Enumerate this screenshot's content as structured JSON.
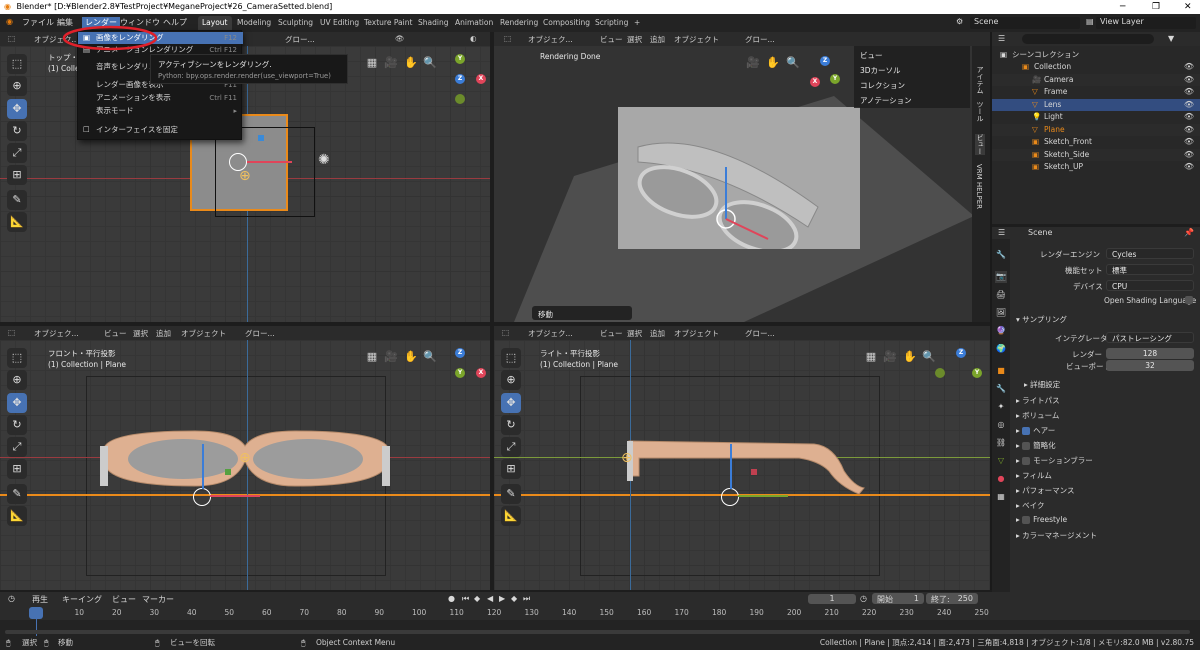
{
  "window": {
    "title": "Blender* [D:¥Blender2.8¥TestProject¥MeganeProject¥26_CameraSetted.blend]",
    "minimize": "─",
    "maximize": "❐",
    "close": "✕"
  },
  "topbar": {
    "menus": [
      "ファイル",
      "編集",
      "レンダー",
      "ウィンドウ",
      "ヘルプ"
    ],
    "workspaces": [
      "Layout",
      "Modeling",
      "Sculpting",
      "UV Editing",
      "Texture Paint",
      "Shading",
      "Animation",
      "Rendering",
      "Compositing",
      "Scripting",
      "+"
    ],
    "active_workspace": "Layout",
    "scene": "Scene",
    "view_layer": "View Layer"
  },
  "render_menu": {
    "items": [
      {
        "label": "画像をレンダリング",
        "shortcut": "F12",
        "icon": "📷"
      },
      {
        "label": "アニメーションレンダリング",
        "shortcut": "Ctrl F12",
        "icon": "🎞"
      },
      {
        "label": "音声をレンダリング...",
        "shortcut": "",
        "icon": ""
      },
      {
        "label": "レンダー画像を表示",
        "shortcut": "F11",
        "icon": ""
      },
      {
        "label": "アニメーションを表示",
        "shortcut": "Ctrl F11",
        "icon": ""
      },
      {
        "label": "表示モード",
        "shortcut": "▸",
        "icon": ""
      },
      {
        "label": "インターフェイスを固定",
        "shortcut": "",
        "icon": "☐"
      }
    ],
    "tooltip_title": "アクティブシーンをレンダリング.",
    "tooltip_python": "Python: bpy.ops.render.render(use_viewport=True)"
  },
  "viewport_header": {
    "mode": "オブジェク...",
    "view": "ビュー",
    "select": "選択",
    "add": "追加",
    "object": "オブジェクト",
    "orientation": "グロー..."
  },
  "viewports": {
    "top_left": {
      "label": "トップ・平行投影",
      "sub": "(1) Collection | Plane"
    },
    "top_right": {
      "label": "Rendering Done",
      "sidebar": [
        "ビュー",
        "3Dカーソル",
        "コレクション",
        "アノテーション"
      ],
      "move_panel": "移動"
    },
    "bottom_left": {
      "label": "フロント・平行投影",
      "sub": "(1) Collection | Plane"
    },
    "bottom_right": {
      "label": "ライト・平行投影",
      "sub": "(1) Collection | Plane"
    },
    "side_tabs": [
      "アイテム",
      "ツール",
      "ビュー",
      "VRM HELPER"
    ]
  },
  "outliner": {
    "root": "シーンコレクション",
    "rows": [
      {
        "name": "Collection",
        "icon": "▣",
        "color": "#d8d8d8",
        "indent": 1,
        "selected": false
      },
      {
        "name": "Camera",
        "icon": "🎥",
        "color": "#d8d8d8",
        "indent": 2,
        "selected": false
      },
      {
        "name": "Frame",
        "icon": "▽",
        "color": "#d8d8d8",
        "indent": 2,
        "selected": false
      },
      {
        "name": "Lens",
        "icon": "▽",
        "color": "#d8d8d8",
        "indent": 2,
        "selected": true
      },
      {
        "name": "Light",
        "icon": "💡",
        "color": "#d8d8d8",
        "indent": 2,
        "selected": false
      },
      {
        "name": "Plane",
        "icon": "▽",
        "color": "#ea8a1a",
        "indent": 2,
        "selected": false
      },
      {
        "name": "Sketch_Front",
        "icon": "▣",
        "color": "#d8d8d8",
        "indent": 2,
        "selected": false
      },
      {
        "name": "Sketch_Side",
        "icon": "▣",
        "color": "#d8d8d8",
        "indent": 2,
        "selected": false
      },
      {
        "name": "Sketch_UP",
        "icon": "▣",
        "color": "#d8d8d8",
        "indent": 2,
        "selected": false
      }
    ]
  },
  "properties": {
    "scene_name": "Scene",
    "render_engine_label": "レンダーエンジン",
    "render_engine": "Cycles",
    "feature_set_label": "機能セット",
    "feature_set": "標準",
    "device_label": "デバイス",
    "device": "CPU",
    "osl_label": "Open Shading Language",
    "sampling": "サンプリング",
    "integrator_label": "インテグレータ",
    "integrator": "パストレーシング",
    "render_label": "レンダー",
    "render_samples": "128",
    "viewport_label": "ビューポート",
    "viewport_samples": "32",
    "advanced": "詳細設定",
    "sections": [
      {
        "label": "ライトパス",
        "checkbox": "none"
      },
      {
        "label": "ボリューム",
        "checkbox": "none"
      },
      {
        "label": "ヘアー",
        "checkbox": "on"
      },
      {
        "label": "簡略化",
        "checkbox": "off"
      },
      {
        "label": "モーションブラー",
        "checkbox": "off"
      },
      {
        "label": "フィルム",
        "checkbox": "none"
      },
      {
        "label": "パフォーマンス",
        "checkbox": "none"
      },
      {
        "label": "ベイク",
        "checkbox": "none"
      },
      {
        "label": "Freestyle",
        "checkbox": "off"
      },
      {
        "label": "カラーマネージメント",
        "checkbox": "none"
      }
    ]
  },
  "timeline": {
    "menus": [
      "再生",
      "キーイング",
      "ビュー",
      "マーカー"
    ],
    "current_frame": "1",
    "start_label": "開始",
    "start": "1",
    "end_label": "終了:",
    "end": "250",
    "ticks": [
      "1",
      "10",
      "20",
      "30",
      "40",
      "50",
      "60",
      "70",
      "80",
      "90",
      "100",
      "110",
      "120",
      "130",
      "140",
      "150",
      "160",
      "170",
      "180",
      "190",
      "200",
      "210",
      "220",
      "230",
      "240",
      "250"
    ]
  },
  "statusbar": {
    "select": "選択",
    "move": "移動",
    "rotate_view": "ビューを回転",
    "context_menu": "Object Context Menu",
    "stats": "Collection | Plane | 頂点:2,414 | 面:2,473 | 三角面:4,818 | オブジェクト:1/8 | メモリ:82.0 MB | v2.80.75"
  }
}
